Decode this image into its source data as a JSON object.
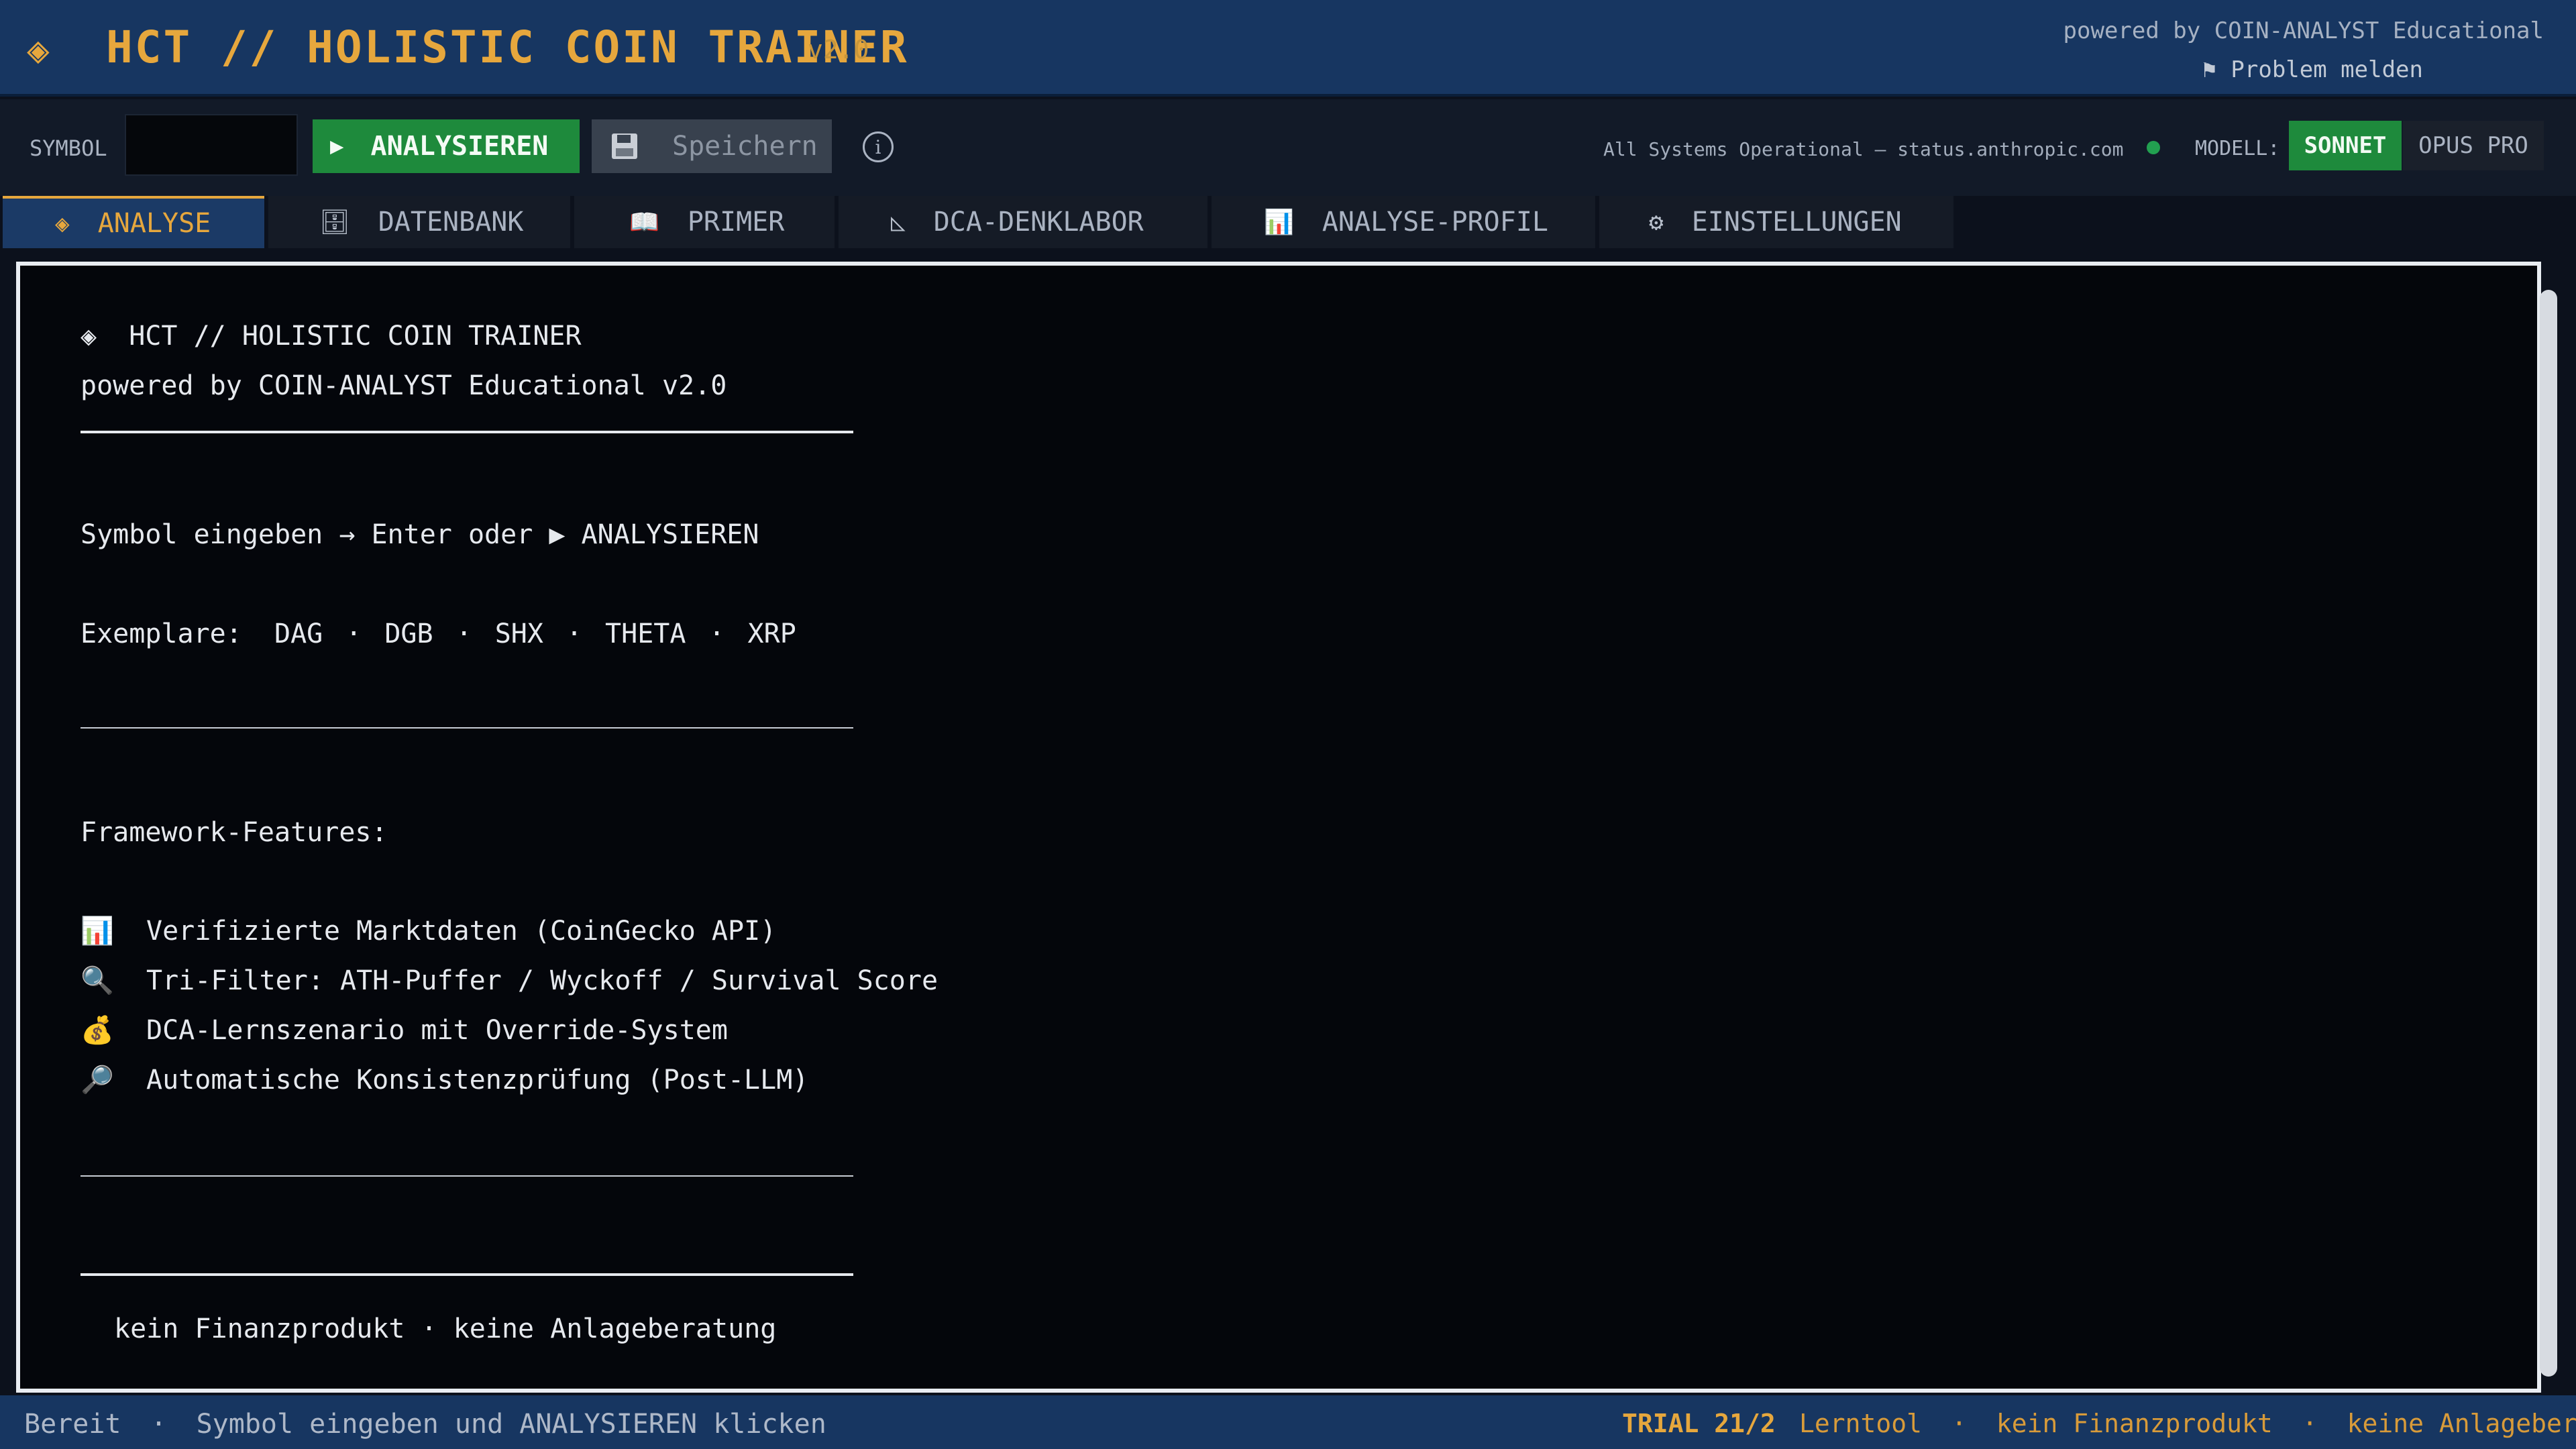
{
  "header": {
    "logo": "◈",
    "title": "HCT // HOLISTIC COIN TRAINER",
    "version": "v2.0",
    "powered": "powered by COIN-ANALYST Educational",
    "report_icon": "⚑",
    "report_label": "Problem melden"
  },
  "toolbar": {
    "symbol_label": "SYMBOL",
    "symbol_value": "",
    "analyse_icon": "▶",
    "analyse_label": "ANALYSIEREN",
    "save_label": "Speichern",
    "info_icon": "i",
    "status_text": "All Systems Operational – status.anthropic.com",
    "status_color": "#22a050",
    "model_label": "MODELL:",
    "model_sonnet": "SONNET",
    "model_opus": "OPUS PRO"
  },
  "tabs": [
    {
      "icon": "◈",
      "label": "ANALYSE",
      "active": true
    },
    {
      "icon": "🗄",
      "label": "DATENBANK"
    },
    {
      "icon": "📖",
      "label": "PRIMER"
    },
    {
      "icon": "◺",
      "label": "DCA-DENKLABOR"
    },
    {
      "icon": "📊",
      "label": "ANALYSE-PROFIL"
    },
    {
      "icon": "⚙",
      "label": "EINSTELLUNGEN"
    }
  ],
  "main": {
    "title_icon": "◈",
    "title": "HCT // HOLISTIC COIN TRAINER",
    "powered": "powered by COIN-ANALYST Educational v2.0",
    "instruction": "Symbol eingeben → Enter oder ▶ ANALYSIEREN",
    "examples_label": "Exemplare:",
    "examples": [
      "DAG",
      "DGB",
      "SHX",
      "THETA",
      "XRP"
    ],
    "example_sep": "·",
    "features_heading": "Framework-Features:",
    "features": [
      {
        "icon": "📊",
        "text": "Verifizierte Marktdaten (CoinGecko API)"
      },
      {
        "icon": "🔍",
        "text": "Tri-Filter: ATH-Puffer / Wyckoff / Survival Score"
      },
      {
        "icon": "💰",
        "text": "DCA-Lernszenario mit Override-System"
      },
      {
        "icon": "🔎",
        "text": "Automatische Konsistenzprüfung (Post-LLM)"
      }
    ],
    "disclaimer": "kein Finanzprodukt · keine Anlageberatung"
  },
  "statusbar": {
    "ready": "Bereit",
    "sep": "·",
    "hint": "Symbol eingeben und ANALYSIEREN klicken",
    "trial": "TRIAL 21/2",
    "tags": [
      "Lerntool",
      "kein Finanzprodukt",
      "keine Anlageberatung"
    ]
  },
  "colors": {
    "accent": "#e6a73d",
    "header_bg": "#173661",
    "action_green": "#1e8a3c"
  }
}
